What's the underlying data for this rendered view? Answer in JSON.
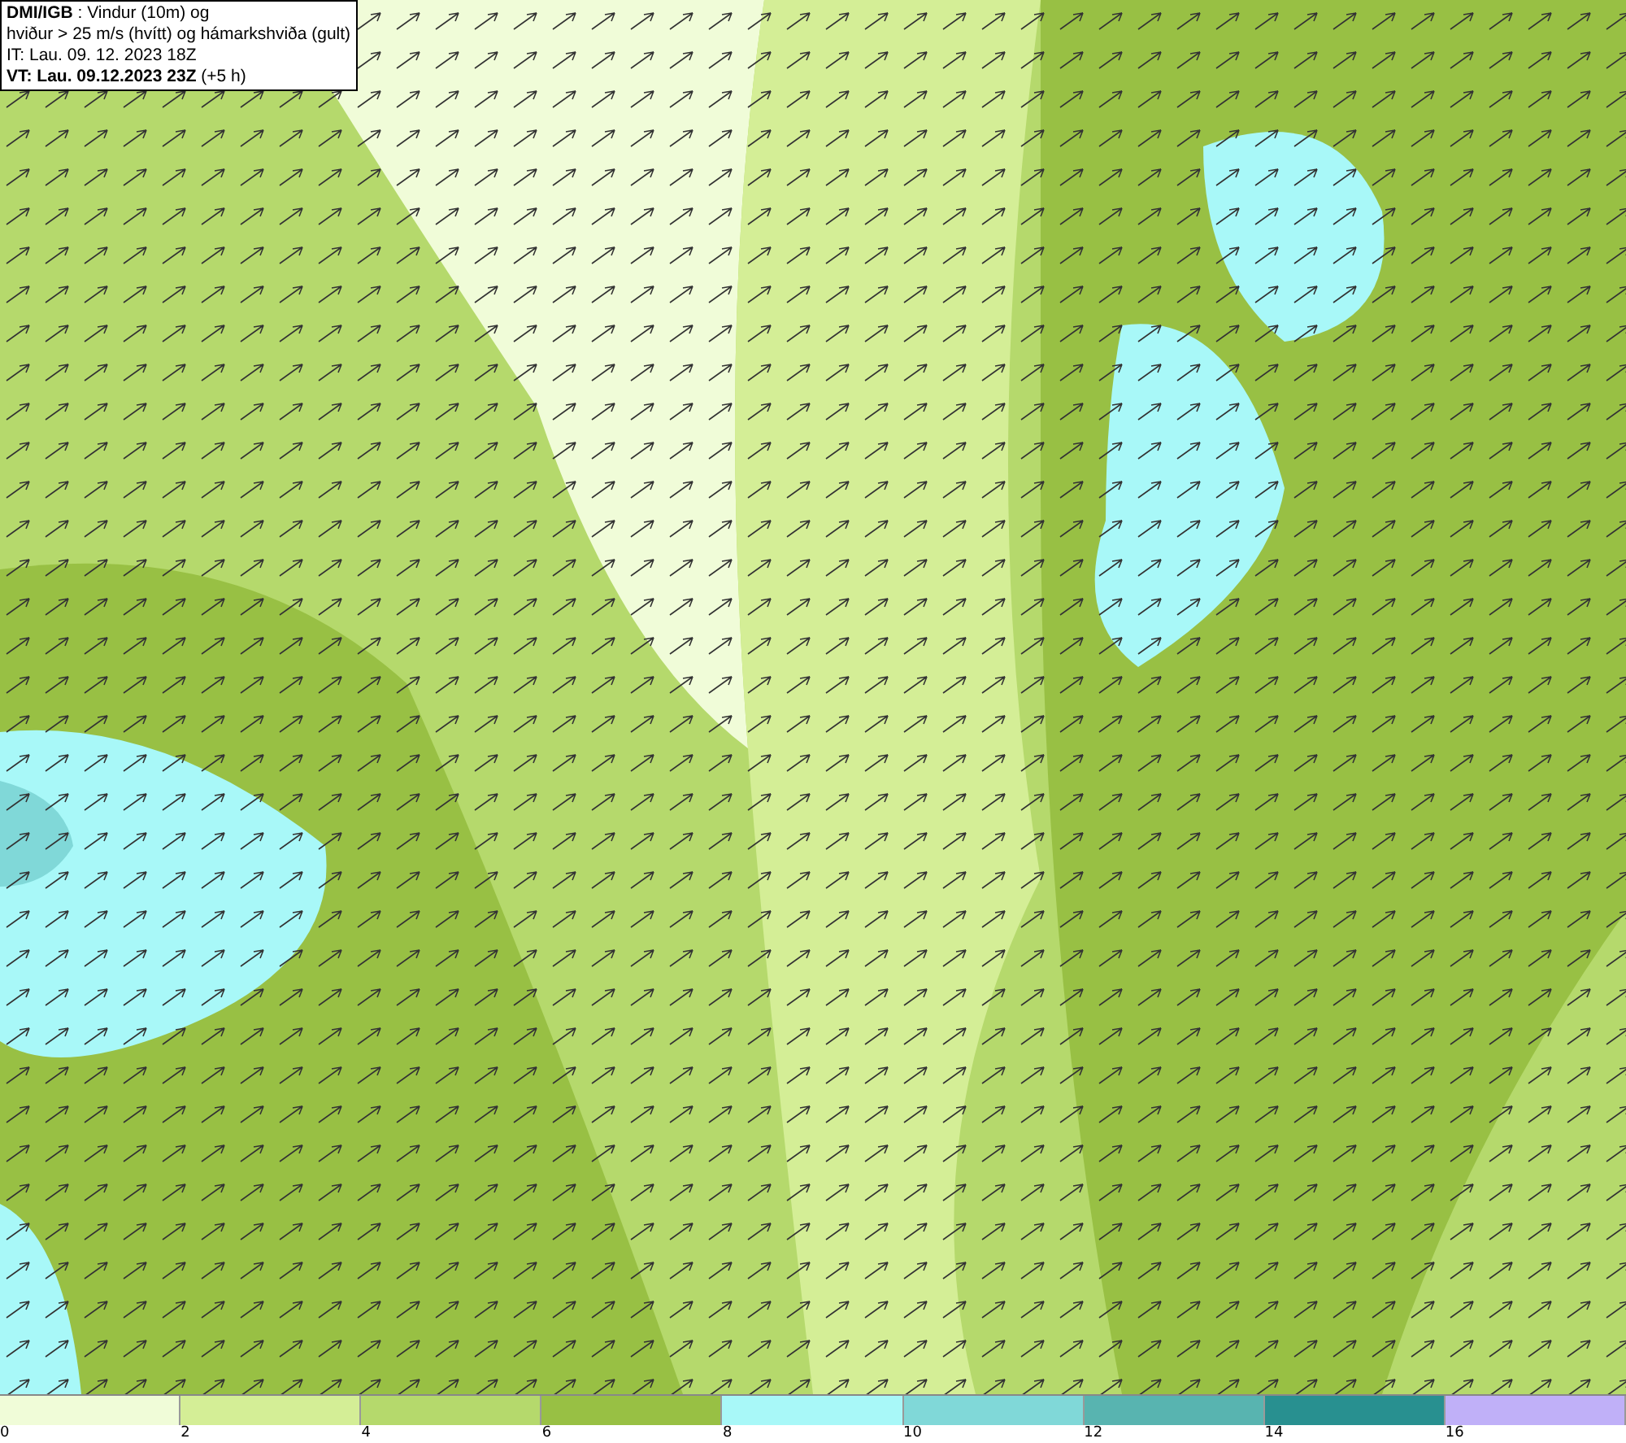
{
  "header": {
    "lines": [
      "**DMI/IGB** : Vindur (10m) og",
      "hviður > 25 m/s (hvítt) og hámarkshviða (gult)",
      "IT: Lau. 09. 12. 2023 18Z",
      "**VT: Lau. 09.12.2023 23Z** (+5 h)"
    ]
  },
  "legend": {
    "segments": [
      {
        "label": "0",
        "color": "#f0fcd8"
      },
      {
        "label": "2",
        "color": "#d4ee96"
      },
      {
        "label": "4",
        "color": "#b5d96c"
      },
      {
        "label": "6",
        "color": "#98c044"
      },
      {
        "label": "8",
        "color": "#a8f8f8"
      },
      {
        "label": "10",
        "color": "#80d8d8"
      },
      {
        "label": "12",
        "color": "#58b4b0"
      },
      {
        "label": "14",
        "color": "#289090"
      },
      {
        "label": "16",
        "color": "#c0b0f8"
      }
    ]
  }
}
